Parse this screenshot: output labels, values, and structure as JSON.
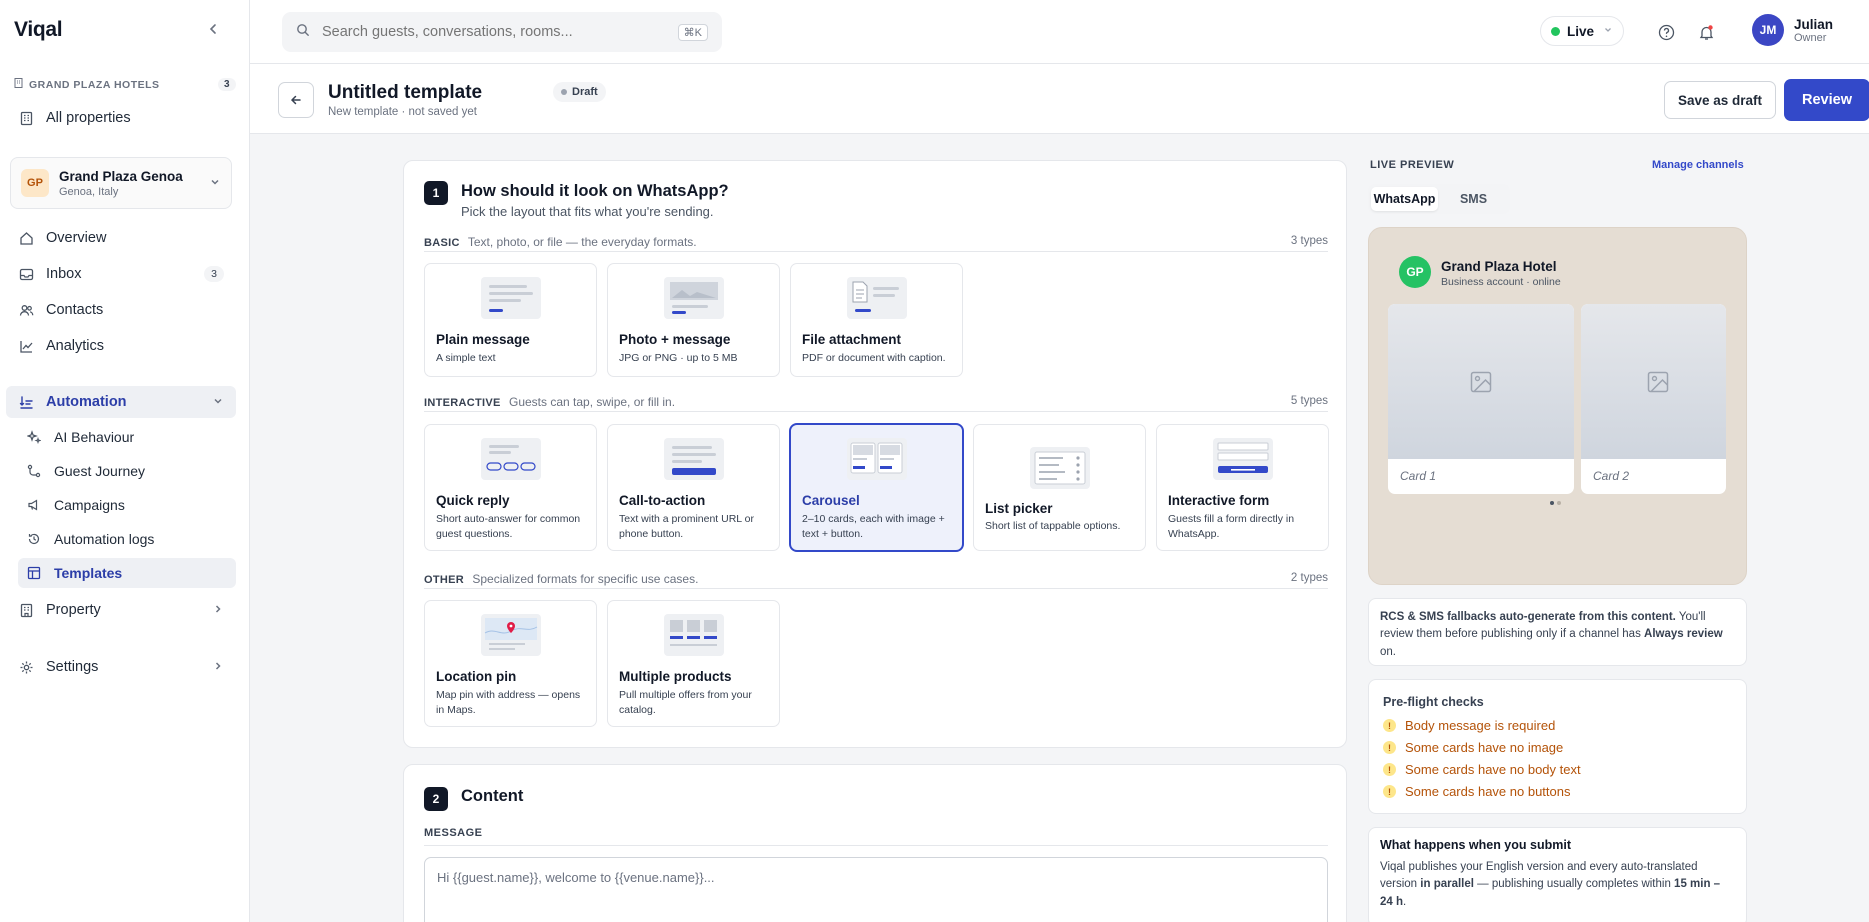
{
  "app": {
    "logo": "Viqal"
  },
  "sidebar": {
    "org_label": "GRAND PLAZA HOTELS",
    "org_count": "3",
    "all_properties": "All properties",
    "property": {
      "initials": "GP",
      "name": "Grand Plaza Genoa",
      "location": "Genoa, Italy"
    },
    "nav": {
      "overview": "Overview",
      "inbox": "Inbox",
      "inbox_count": "3",
      "contacts": "Contacts",
      "analytics": "Analytics",
      "automation": "Automation",
      "ai_behaviour": "AI Behaviour",
      "guest_journey": "Guest Journey",
      "campaigns": "Campaigns",
      "automation_logs": "Automation logs",
      "templates": "Templates",
      "property": "Property",
      "settings": "Settings"
    }
  },
  "topbar": {
    "search_placeholder": "Search guests, conversations, rooms...",
    "search_shortcut": "⌘K",
    "status": "Live",
    "user": {
      "initials": "JM",
      "name": "Julian",
      "role": "Owner"
    }
  },
  "header": {
    "title": "Untitled template",
    "subtitle": "New template · not saved yet",
    "status_badge": "Draft",
    "save_draft": "Save as draft",
    "review": "Review"
  },
  "step1": {
    "number": "1",
    "title": "How should it look on WhatsApp?",
    "subtitle": "Pick the layout that fits what you're sending.",
    "groups": {
      "basic": {
        "name": "BASIC",
        "desc": "Text, photo, or file — the everyday formats.",
        "count": "3 types"
      },
      "interactive": {
        "name": "INTERACTIVE",
        "desc": "Guests can tap, swipe, or fill in.",
        "count": "5 types"
      },
      "other": {
        "name": "OTHER",
        "desc": "Specialized formats for specific use cases.",
        "count": "2 types"
      }
    },
    "types": {
      "plain": {
        "name": "Plain message",
        "desc": "A simple text"
      },
      "photo": {
        "name": "Photo + message",
        "desc": "JPG or PNG · up to 5 MB"
      },
      "file": {
        "name": "File attachment",
        "desc": "PDF or document with caption."
      },
      "quick_reply": {
        "name": "Quick reply",
        "desc": "Short auto-answer for common guest questions."
      },
      "cta": {
        "name": "Call-to-action",
        "desc": "Text with a prominent URL or phone button."
      },
      "carousel": {
        "name": "Carousel",
        "desc": "2–10 cards, each with image + text + button."
      },
      "list_picker": {
        "name": "List picker",
        "desc": "Short list of tappable options."
      },
      "form": {
        "name": "Interactive form",
        "desc": "Guests fill a form directly in WhatsApp."
      },
      "location": {
        "name": "Location pin",
        "desc": "Map pin with address — opens in Maps."
      },
      "products": {
        "name": "Multiple products",
        "desc": "Pull multiple offers from your catalog."
      }
    },
    "selected": "carousel"
  },
  "step2": {
    "number": "2",
    "title": "Content",
    "message_label": "MESSAGE",
    "message_placeholder": "Hi {{guest.name}}, welcome to {{venue.name}}..."
  },
  "preview": {
    "label": "LIVE PREVIEW",
    "manage": "Manage channels",
    "tabs": [
      "WhatsApp",
      "SMS"
    ],
    "active_tab": "WhatsApp",
    "business": {
      "initials": "GP",
      "name": "Grand Plaza Hotel",
      "status": "Business account · online"
    },
    "cards": [
      "Card 1",
      "Card 2"
    ]
  },
  "fallback": {
    "bold": "RCS & SMS fallbacks auto-generate from this content.",
    "text": " You'll review them before publishing only if a channel has ",
    "bold2": "Always review",
    "tail": " on."
  },
  "preflight": {
    "title": "Pre-flight checks",
    "items": [
      "Body message is required",
      "Some cards have no image",
      "Some cards have no body text",
      "Some cards have no buttons"
    ]
  },
  "submit": {
    "title": "What happens when you submit",
    "p1": "Viqal publishes your English version and every auto-translated version ",
    "b1": "in parallel",
    "p2": " — publishing usually completes within ",
    "b2": "15 min – 24 h",
    "p3": "."
  },
  "colors": {
    "accent": "#3349c9",
    "live": "#22c55e",
    "whatsapp": "#25c264",
    "warning": "#b45309"
  }
}
